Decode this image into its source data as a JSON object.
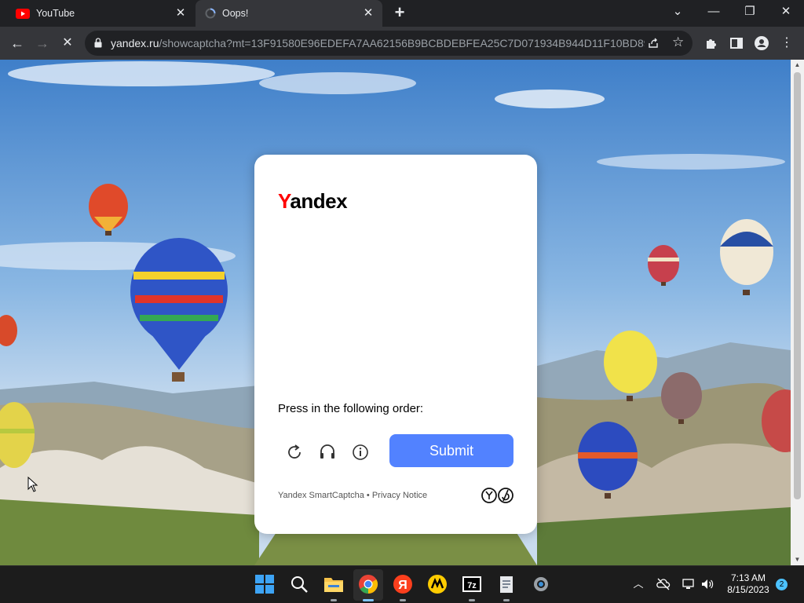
{
  "browser": {
    "tabs": [
      {
        "title": "YouTube",
        "icon": "youtube-icon",
        "active": false
      },
      {
        "title": "Oops!",
        "icon": "loading-spinner-icon",
        "active": true
      }
    ],
    "address": {
      "host": "yandex.ru",
      "path": "/showcaptcha?mt=13F91580E96EDEFA7AA62156B9BCBDEBFEA25C7D071934B944D11F10BD8981..."
    }
  },
  "captcha": {
    "logo_first": "Y",
    "logo_rest": "andex",
    "instruction": "Press in the following order:",
    "submit_label": "Submit",
    "footer_brand": "Yandex SmartCaptcha",
    "footer_sep": " • ",
    "footer_privacy": "Privacy Notice"
  },
  "taskbar": {
    "time": "7:13 AM",
    "date": "8/15/2023",
    "notifications": "2"
  },
  "colors": {
    "submit": "#5282ff",
    "yandex_red": "#ff0000",
    "chrome_dark": "#202124",
    "toolbar": "#35363a"
  }
}
